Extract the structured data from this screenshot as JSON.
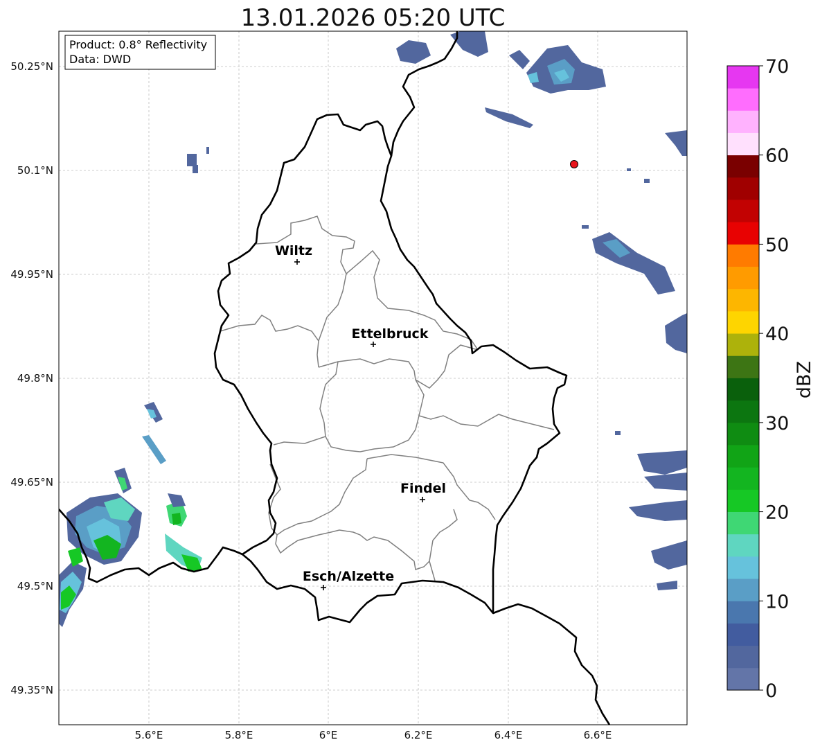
{
  "map": {
    "title": "13.01.2026 05:20 UTC",
    "info_box": {
      "product": "Product: 0.8° Reflectivity",
      "source": "Data: DWD"
    },
    "lat_labels": [
      "50.25°N",
      "50.1°N",
      "49.95°N",
      "49.8°N",
      "49.65°N",
      "49.5°N",
      "49.35°N"
    ],
    "lon_labels": [
      "5.6°E",
      "5.8°E",
      "6°E",
      "6.2°E",
      "6.4°E",
      "6.6°E"
    ],
    "cities": [
      {
        "name": "Wiltz"
      },
      {
        "name": "Ettelbruck"
      },
      {
        "name": "Findel"
      },
      {
        "name": "Esch/Alzette"
      }
    ],
    "radar_site_color": "#e8141c",
    "colorbar": {
      "unit": "dBZ",
      "ticks": [
        "0",
        "10",
        "20",
        "30",
        "40",
        "50",
        "60",
        "70"
      ],
      "colors": [
        "#6375a8",
        "#52679e",
        "#425c9f",
        "#4a77ae",
        "#5a9ec6",
        "#66c2dc",
        "#5fd6c0",
        "#3fd774",
        "#16c825",
        "#13b520",
        "#11a416",
        "#0f8c12",
        "#0c7610",
        "#0a600c",
        "#3d7514",
        "#adb20b",
        "#fed500",
        "#fdb600",
        "#ff9b00",
        "#ff7b00",
        "#e80202",
        "#c20202",
        "#a00000",
        "#7a0000",
        "#ffe0fd",
        "#ffb2fe",
        "#ff6dfe",
        "#e637f1"
      ]
    }
  }
}
